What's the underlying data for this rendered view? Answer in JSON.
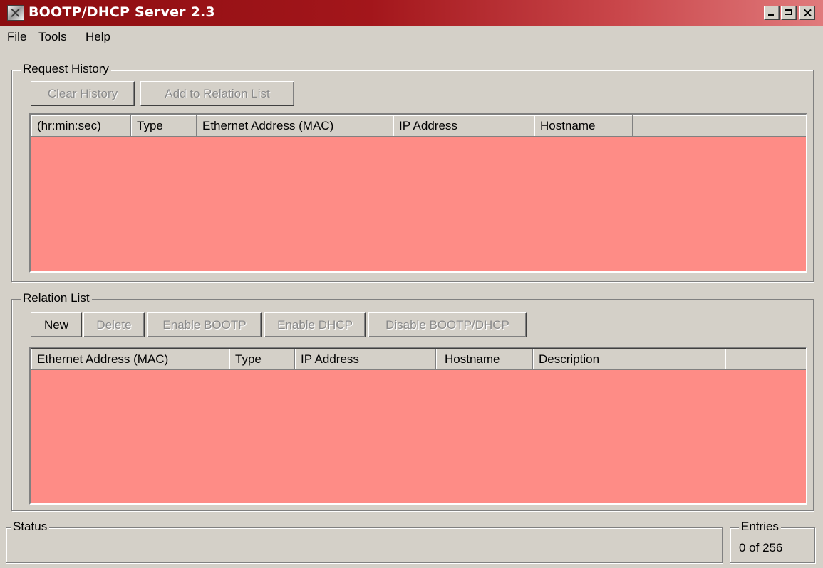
{
  "window": {
    "title": "BOOTP/DHCP Server 2.3"
  },
  "menu": [
    "File",
    "Tools",
    "Help"
  ],
  "request_history": {
    "label": "Request History",
    "buttons": {
      "clear_history": "Clear History",
      "add_to_relation_list": "Add to Relation List"
    },
    "columns": [
      "(hr:min:sec)",
      "Type",
      "Ethernet Address (MAC)",
      "IP Address",
      "Hostname"
    ]
  },
  "relation_list": {
    "label": "Relation List",
    "buttons": {
      "new": "New",
      "delete": "Delete",
      "enable_bootp": "Enable BOOTP",
      "enable_dhcp": "Enable DHCP",
      "disable_bootp_dhcp": "Disable BOOTP/DHCP"
    },
    "columns": [
      "Ethernet Address (MAC)",
      "Type",
      "IP Address",
      "Hostname",
      "Description"
    ]
  },
  "status": {
    "label": "Status",
    "text": ""
  },
  "entries": {
    "label": "Entries",
    "value": "0 of 256"
  },
  "colors": {
    "titlebar_start": "#8b0d10",
    "titlebar_end": "#e07a7c",
    "list_background": "#fe8c86",
    "window_face": "#d4d0c8"
  },
  "icons": [
    "app-icon",
    "minimize-icon",
    "maximize-icon",
    "close-icon"
  ]
}
